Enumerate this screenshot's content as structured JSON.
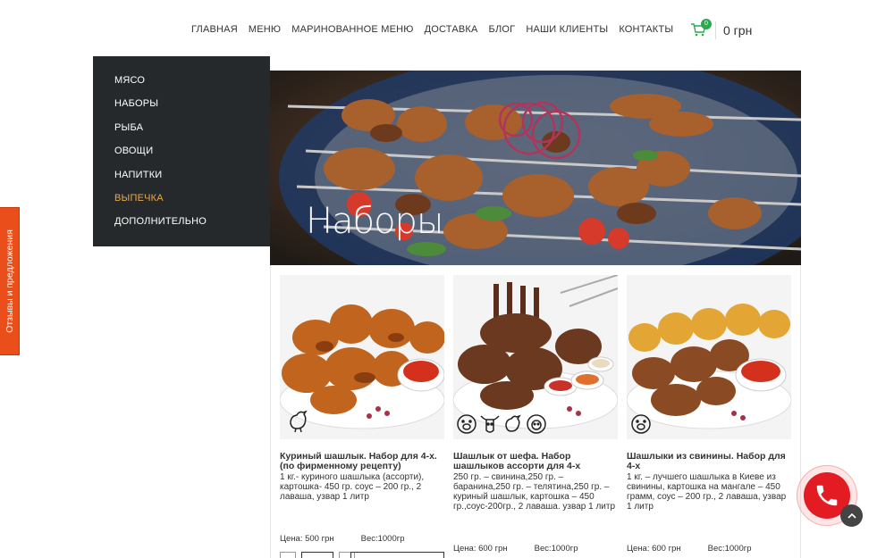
{
  "nav": {
    "items": [
      "ГЛАВНАЯ",
      "МЕНЮ",
      "МАРИНОВАННОЕ МЕНЮ",
      "ДОСТАВКА",
      "БЛОГ",
      "НАШИ КЛИЕНТЫ",
      "КОНТАКТЫ"
    ]
  },
  "cart": {
    "count": "0",
    "total": "0 грн",
    "icon": "cart-icon"
  },
  "sidebar": {
    "items": [
      {
        "label": "МЯСО"
      },
      {
        "label": "НАБОРЫ"
      },
      {
        "label": "РЫБА"
      },
      {
        "label": "ОВОЩИ"
      },
      {
        "label": "НАПИТКИ"
      },
      {
        "label": "ВЫПЕЧКА",
        "active": true
      },
      {
        "label": "ДОПОЛНИТЕЛЬНО"
      }
    ]
  },
  "hero": {
    "title": "Наборы"
  },
  "products": [
    {
      "title": "Куриный шашлык. Набор для 4-х. (по фирменному рецепту)",
      "desc": "1 кг.- куриного шашлыка (ассорти), картошка- 450 гр. соус – 200 гр., 2 лаваша, узвар 1 литр",
      "price": "Цена: 500 грн",
      "weight": "Вес:1000гр",
      "icons": [
        "chicken-icon"
      ]
    },
    {
      "title": "Шашлык от шефа. Набор шашлыков ассорти для 4-х",
      "desc": "250 гр. – свинина,250 гр. – баранина,250 гр. – телятина,250 гр. – куриный шашлык, картошка – 450 гр.,соус-200гр., 2 лаваша. узвар 1 литр",
      "price": "Цена: 600 грн",
      "weight": "Вес:1000гр",
      "icons": [
        "pig-icon",
        "cow-icon",
        "chicken-icon",
        "sheep-icon"
      ]
    },
    {
      "title": "Шашлыки из свинины. Набор для 4-х",
      "desc": "1 кг. – лучшего шашлыка в Киеве из свинины, картошка на мангале – 450 грамм, соус – 200 гр., 2 лаваша, узвар 1 литр",
      "price": "Цена: 600 грн",
      "weight": "Вес:1000гр",
      "icons": [
        "pig-icon"
      ]
    }
  ],
  "side_tab": {
    "label": "Отзывы и предложения"
  },
  "colors": {
    "sidebar_bg": "#26292c",
    "accent": "#e8a74c",
    "phone": "#e31b23",
    "tab": "#e94e1b"
  }
}
